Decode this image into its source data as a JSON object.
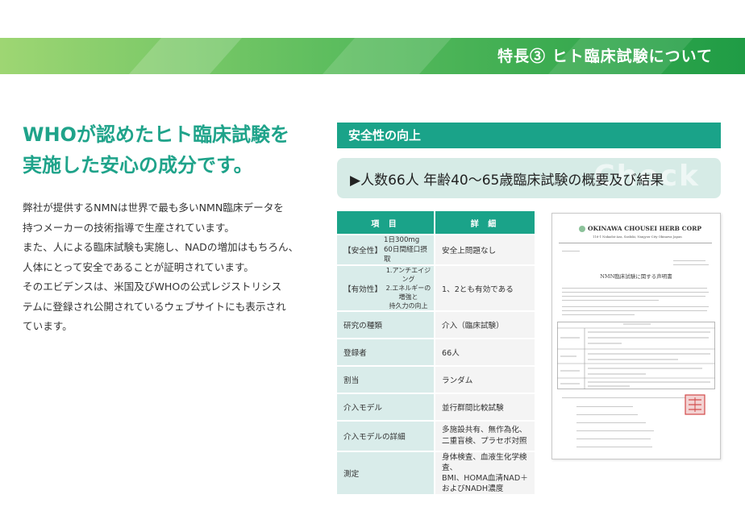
{
  "banner": {
    "title": "特長③ ヒト臨床試験について"
  },
  "headline": {
    "line1": "WHOが認めたヒト臨床試験を",
    "line2": "実施した安心の成分です。"
  },
  "body": {
    "lines": [
      "弊社が提供するNMNは世界で最も多いNMN臨床データを",
      "持つメーカーの技術指導で生産されています。",
      "また、人による臨床試験も実施し、NADの増加はもちろん、",
      "人体にとって安全であることが証明されています。",
      "そのエビデンスは、米国及びWHOの公式レジストリシス",
      "テムに登録され公開されているウェブサイトにも表示され",
      "ています。"
    ]
  },
  "section": {
    "title": "安全性の向上"
  },
  "summary": {
    "watermark": "Check",
    "text": "▶人数66人 年齢40～65歳臨床試験の概要及び結果"
  },
  "table": {
    "header_item": "項 目",
    "header_detail": "詳 細",
    "rows": [
      {
        "k": "【安全性】",
        "k2": "1日300mg",
        "k3": "60日間経口摂取",
        "v": "安全上問題なし"
      },
      {
        "k": "【有効性】",
        "k2": "1.アンチエイジング",
        "k3": "2.エネルギーの増強と",
        "k4": "持久力の向上",
        "v": "1、2とも有効である"
      },
      {
        "k": "研究の種類",
        "v": "介入（臨床試験）"
      },
      {
        "k": "登録者",
        "v": "66人"
      },
      {
        "k": "割当",
        "v": "ランダム"
      },
      {
        "k": "介入モデル",
        "v": "並行群間比較試験"
      },
      {
        "k": "介入モデルの詳細",
        "v": "多施設共有、無作為化、",
        "v2": "二重盲検、プラセボ対照"
      },
      {
        "k": "測定",
        "v": "身体検査、血液生化学検査、",
        "v2": "BMI、HOMA血清NAD＋",
        "v3": "およびNADH濃度"
      }
    ]
  },
  "letter": {
    "company": "OKINAWA CHOUSEI HERB CORP",
    "address": "116-1 Nakadoi-Aza, Sashiki, Nanjyou-City Okinawa Japan",
    "doc_title": "NMN臨床試験に関する声明書"
  }
}
